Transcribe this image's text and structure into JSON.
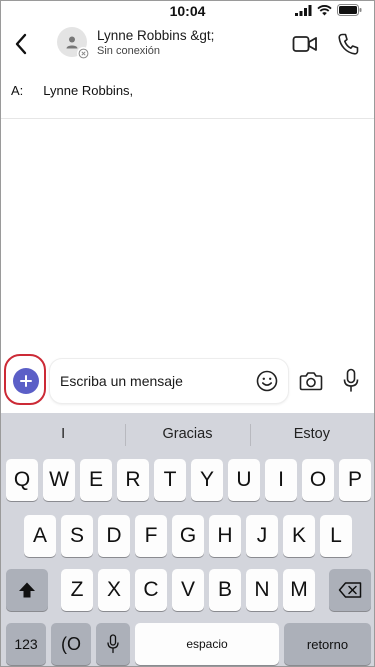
{
  "status_bar": {
    "time": "10:04"
  },
  "header": {
    "contact_name": "Lynne Robbins &gt;",
    "contact_status": "Sin conexión"
  },
  "to_line": {
    "label": "A:",
    "recipient": "Lynne Robbins,"
  },
  "compose": {
    "placeholder": "Escriba un mensaje"
  },
  "keyboard": {
    "suggestions": [
      "I",
      "Gracias",
      "Estoy"
    ],
    "row1": [
      "Q",
      "W",
      "E",
      "R",
      "T",
      "Y",
      "U",
      "I",
      "O",
      "P"
    ],
    "row2": [
      "A",
      "S",
      "D",
      "F",
      "G",
      "H",
      "J",
      "K",
      "L"
    ],
    "row3": [
      "Z",
      "X",
      "C",
      "V",
      "B",
      "N",
      "M"
    ],
    "numbers_label": "123",
    "emoji_key_label": "(O",
    "space_label": "espacio",
    "return_label": "retorno"
  },
  "colors": {
    "accent": "#5b5fc7",
    "highlight": "#cc2a36",
    "keyboard_bg": "#d3d5dc"
  }
}
